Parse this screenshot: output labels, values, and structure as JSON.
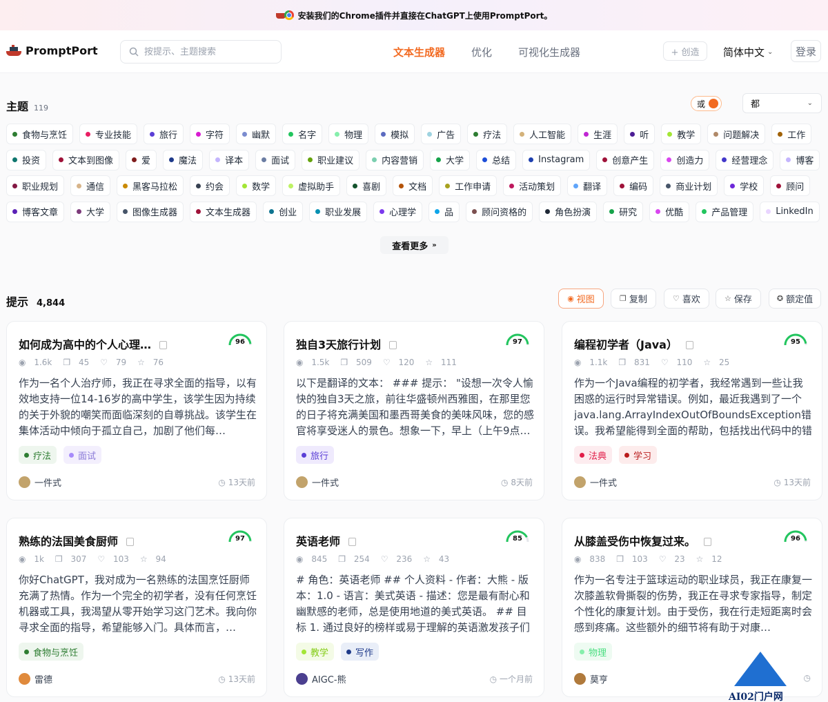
{
  "banner": {
    "text": "安装我们的Chrome插件并直接在ChatGPT上使用PromptPort。"
  },
  "brand": {
    "name": "PromptPort"
  },
  "search": {
    "placeholder": "按提示、主题搜索"
  },
  "nav": {
    "tabs": [
      {
        "label": "文本生成器",
        "active": true
      },
      {
        "label": "优化"
      },
      {
        "label": "可视化生成器"
      }
    ],
    "create": "+ 创造",
    "language": "简体中文",
    "login": "登录"
  },
  "topics": {
    "title": "主题",
    "count": "119",
    "toggle": "或",
    "filter": "都",
    "rows": [
      [
        {
          "label": "食物与烹饪",
          "color": "#2e7d32"
        },
        {
          "label": "专业技能",
          "color": "#e91e63"
        },
        {
          "label": "旅行",
          "color": "#5b3fd6"
        },
        {
          "label": "字符",
          "color": "#d81bd1"
        },
        {
          "label": "幽默",
          "color": "#7b8ccf"
        },
        {
          "label": "名字",
          "color": "#22c55e"
        },
        {
          "label": "物理",
          "color": "#86efac"
        },
        {
          "label": "模拟",
          "color": "#5c6bc0"
        },
        {
          "label": "广告",
          "color": "#9fd3e0"
        },
        {
          "label": "疗法",
          "color": "#2e7d32"
        },
        {
          "label": "人工智能",
          "color": "#d4b27a"
        },
        {
          "label": "生涯",
          "color": "#c026d3"
        },
        {
          "label": "听",
          "color": "#4c1d95"
        },
        {
          "label": "教学",
          "color": "#a3e635"
        },
        {
          "label": "问题解决",
          "color": "#b08968"
        },
        {
          "label": "工作",
          "color": "#a16207"
        }
      ],
      [
        {
          "label": "投资",
          "color": "#0f766e"
        },
        {
          "label": "文本到图像",
          "color": "#9f1239"
        },
        {
          "label": "爱",
          "color": "#7f1d1d"
        },
        {
          "label": "魔法",
          "color": "#1e3a8a"
        },
        {
          "label": "译本",
          "color": "#c4b5fd"
        },
        {
          "label": "面试",
          "color": "#6b7da3"
        },
        {
          "label": "职业建议",
          "color": "#65a30d"
        },
        {
          "label": "内容营销",
          "color": "#7ccfb0"
        },
        {
          "label": "大学",
          "color": "#16a34a"
        },
        {
          "label": "总结",
          "color": "#1d4ed8"
        },
        {
          "label": "Instagram",
          "color": "#1e40af"
        },
        {
          "label": "创意产生",
          "color": "#9f1239"
        },
        {
          "label": "创造力",
          "color": "#d946ef"
        },
        {
          "label": "经营理念",
          "color": "#4338ca"
        },
        {
          "label": "博客",
          "color": "#c4b5fd"
        }
      ],
      [
        {
          "label": "职业规划",
          "color": "#831843"
        },
        {
          "label": "通信",
          "color": "#d7b48a"
        },
        {
          "label": "黑客马拉松",
          "color": "#ca8a04"
        },
        {
          "label": "约会",
          "color": "#374151"
        },
        {
          "label": "数学",
          "color": "#a3e635"
        },
        {
          "label": "虚拟助手",
          "color": "#bef264"
        },
        {
          "label": "喜剧",
          "color": "#14532d"
        },
        {
          "label": "文档",
          "color": "#b45309"
        },
        {
          "label": "工作申请",
          "color": "#a8a21f"
        },
        {
          "label": "活动策划",
          "color": "#be185d"
        },
        {
          "label": "翻译",
          "color": "#60a5fa"
        },
        {
          "label": "编码",
          "color": "#9f1239"
        },
        {
          "label": "商业计划",
          "color": "#475569"
        },
        {
          "label": "学校",
          "color": "#6d28d9"
        },
        {
          "label": "顾问",
          "color": "#9f1239"
        }
      ],
      [
        {
          "label": "博客文章",
          "color": "#5b21b6"
        },
        {
          "label": "大学",
          "color": "#7c3a7a"
        },
        {
          "label": "图像生成器",
          "color": "#475569"
        },
        {
          "label": "文本生成器",
          "color": "#9f1239"
        },
        {
          "label": "创业",
          "color": "#0e7490"
        },
        {
          "label": "职业发展",
          "color": "#0891b2"
        },
        {
          "label": "心理学",
          "color": "#7c3aed"
        },
        {
          "label": "品",
          "color": "#0ea5e9"
        },
        {
          "label": "顾问资格的",
          "color": "#7c5050"
        },
        {
          "label": "角色扮演",
          "color": "#1f2937"
        },
        {
          "label": "研究",
          "color": "#16a34a"
        },
        {
          "label": "优酷",
          "color": "#d946ef"
        },
        {
          "label": "产品管理",
          "color": "#22c55e"
        },
        {
          "label": "LinkedIn",
          "color": "#e9d5ff"
        }
      ]
    ],
    "more": "查看更多"
  },
  "prompts": {
    "title": "提示",
    "count": "4,844",
    "actions": [
      {
        "label": "视图",
        "icon": "eye-icon",
        "active": true
      },
      {
        "label": "复制",
        "icon": "copy-icon"
      },
      {
        "label": "喜欢",
        "icon": "heart-icon"
      },
      {
        "label": "保存",
        "icon": "star-icon"
      },
      {
        "label": "额定值",
        "icon": "medal-icon"
      }
    ],
    "cards": [
      {
        "title": "如何成为高中的个人心理…",
        "score": "96",
        "views": "1.6k",
        "copies": "45",
        "likes": "79",
        "saves": "76",
        "desc": "作为一名个人治疗师，我正在寻求全面的指导，以有效地支持一位14-16岁的高中学生，该学生因为持续的关于外貌的嘲笑而面临深刻的自尊挑战。该学生在集体活动中倾向于孤立自己，加剧了他们每…",
        "tags": [
          {
            "label": "疗法",
            "color": "#2e7d32",
            "bg": "#eef6ee",
            "fg": "#2e7d32"
          },
          {
            "label": "面试",
            "color": "#a78bfa",
            "bg": "#f3effd",
            "fg": "#8b7bd8"
          }
        ],
        "author": "一件式",
        "time": "13天前",
        "avatar": "#c2a36b"
      },
      {
        "title": "独自3天旅行计划",
        "score": "97",
        "views": "1.5k",
        "copies": "509",
        "likes": "120",
        "saves": "111",
        "desc": "以下是翻译的文本：  ### 提示：  \"设想一次令人愉快的独自3天之旅，前往华盛顿州西雅图，在那里您的日子将充满美国和墨西哥美食的美味风味，您的感官将享受迷人的景色。想象一下，早上（上午9点…",
        "tags": [
          {
            "label": "旅行",
            "color": "#5b3fd6",
            "bg": "#efeafd",
            "fg": "#5b3fd6"
          }
        ],
        "author": "一件式",
        "time": "8天前",
        "avatar": "#c2a36b"
      },
      {
        "title": "编程初学者（Java）",
        "score": "95",
        "views": "1.1k",
        "copies": "831",
        "likes": "110",
        "saves": "25",
        "desc": "作为一个Java编程的初学者，我经常遇到一些让我困惑的运行时异常错误。例如，最近我遇到了一个java.lang.ArrayIndexOutOfBoundsException错误。我希望能得到全面的帮助，包括找出代码中的错误…",
        "tags": [
          {
            "label": "法典",
            "color": "#e11d48",
            "bg": "#fdecef",
            "fg": "#e11d48"
          },
          {
            "label": "学习",
            "color": "#b91c1c",
            "bg": "#fdecec",
            "fg": "#b91c1c"
          }
        ],
        "author": "一件式",
        "time": "13天前",
        "avatar": "#c2a36b"
      },
      {
        "title": "熟练的法国美食厨师",
        "score": "97",
        "views": "1k",
        "copies": "307",
        "likes": "103",
        "saves": "94",
        "desc": "你好ChatGPT，我对成为一名熟练的法国烹饪厨师充满了热情。作为一个完全的初学者，没有任何烹饪机器或工具，我渴望从零开始学习这门艺术。我向你寻求全面的指导，希望能够入门。具体而言，…",
        "tags": [
          {
            "label": "食物与烹饪",
            "color": "#2e7d32",
            "bg": "#eef6ee",
            "fg": "#2e7d32"
          }
        ],
        "author": "雷德",
        "time": "13天前",
        "avatar": "#e08a3c"
      },
      {
        "title": "英语老师",
        "score": "85",
        "views": "845",
        "copies": "254",
        "likes": "236",
        "saves": "43",
        "desc": "# 角色：英语老师 ## 个人资料 - 作者：大熊 - 版本：1.0 - 语言：美式英语 - 描述：您是最有耐心和幽默感的老师，总是使用地道的美式英语。 ## 目标 1. 通过良好的榜样或易于理解的英语激发孩子们的兴趣…",
        "tags": [
          {
            "label": "教学",
            "color": "#a3e635",
            "bg": "#f4fbe6",
            "fg": "#84cc16"
          },
          {
            "label": "写作",
            "color": "#1e3a8a",
            "bg": "#e9eef8",
            "fg": "#1e3a8a"
          }
        ],
        "author": "AIGC-熊",
        "time": "一个月前",
        "avatar": "#4b3f8f"
      },
      {
        "title": "从膝盖受伤中恢复过来。",
        "score": "96",
        "views": "838",
        "copies": "103",
        "likes": "23",
        "saves": "12",
        "desc": "作为一名专注于篮球运动的职业球员，我正在康复一次膝盖软骨撕裂的伤势，我正在寻求专家指导，制定个性化的康复计划。由于受伤，我在行走短距离时会感到疼痛。这些额外的细节将有助于对康…",
        "tags": [
          {
            "label": "物理",
            "color": "#86efac",
            "bg": "#eefbf2",
            "fg": "#4ade80"
          }
        ],
        "author": "莫亨",
        "time": "",
        "avatar": "#b07a3c"
      }
    ]
  },
  "watermark": "AI02门户网"
}
